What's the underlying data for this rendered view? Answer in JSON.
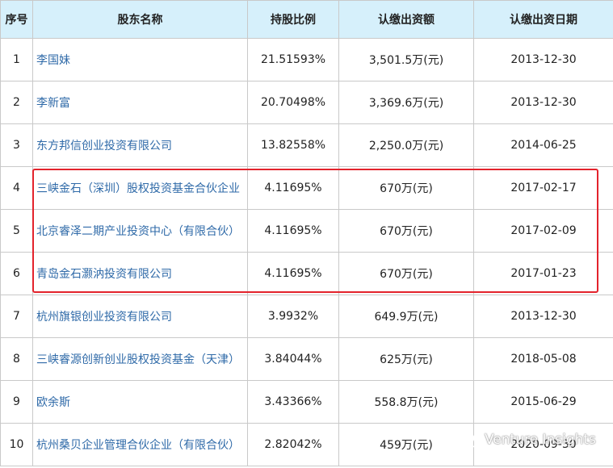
{
  "headers": {
    "index": "序号",
    "name": "股东名称",
    "ratio": "持股比例",
    "amount": "认缴出资额",
    "date": "认缴出资日期"
  },
  "rows": [
    {
      "index": "1",
      "name": "李国妹",
      "ratio": "21.51593%",
      "amount": "3,501.5万(元)",
      "date": "2013-12-30"
    },
    {
      "index": "2",
      "name": "李新富",
      "ratio": "20.70498%",
      "amount": "3,369.6万(元)",
      "date": "2013-12-30"
    },
    {
      "index": "3",
      "name": "东方邦信创业投资有限公司",
      "ratio": "13.82558%",
      "amount": "2,250.0万(元)",
      "date": "2014-06-25"
    },
    {
      "index": "4",
      "name": "三峡金石（深圳）股权投资基金合伙企业",
      "ratio": "4.11695%",
      "amount": "670万(元)",
      "date": "2017-02-17"
    },
    {
      "index": "5",
      "name": "北京睿泽二期产业投资中心（有限合伙）",
      "ratio": "4.11695%",
      "amount": "670万(元)",
      "date": "2017-02-09"
    },
    {
      "index": "6",
      "name": "青岛金石灏汭投资有限公司",
      "ratio": "4.11695%",
      "amount": "670万(元)",
      "date": "2017-01-23"
    },
    {
      "index": "7",
      "name": "杭州旗银创业投资有限公司",
      "ratio": "3.9932%",
      "amount": "649.9万(元)",
      "date": "2013-12-30"
    },
    {
      "index": "8",
      "name": "三峡睿源创新创业股权投资基金（天津）",
      "ratio": "3.84044%",
      "amount": "625万(元)",
      "date": "2018-05-08"
    },
    {
      "index": "9",
      "name": "欧余斯",
      "ratio": "3.43366%",
      "amount": "558.8万(元)",
      "date": "2015-06-29"
    },
    {
      "index": "10",
      "name": "杭州桑贝企业管理合伙企业（有限合伙）",
      "ratio": "2.82042%",
      "amount": "459万(元)",
      "date": "2020-09-30"
    }
  ],
  "watermark": {
    "text": "Venture Insights",
    "icon": "wechat-icon"
  },
  "colors": {
    "header_bg": "#d6f0fb",
    "link": "#2f6aa8",
    "highlight": "#e3232c"
  }
}
